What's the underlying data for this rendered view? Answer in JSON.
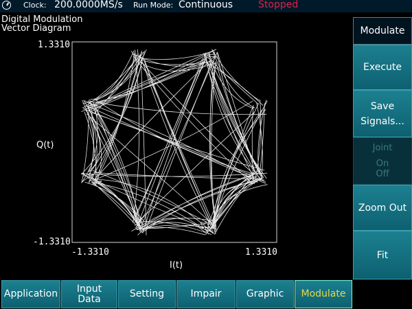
{
  "topbar": {
    "clock_label": "Clock:",
    "clock_value": "200.0000MS/s",
    "run_mode_label": "Run Mode:",
    "run_mode_value": "Continuous",
    "status": "Stopped"
  },
  "panel": {
    "title_line1": "Digital Modulation",
    "title_line2": "Vector Diagram"
  },
  "plot": {
    "y_max_label": "1.3310",
    "y_min_label": "-1.3310",
    "x_min_label": "-1.3310",
    "x_max_label": "1.3310",
    "ylabel": "Q(t)",
    "xlabel": "I(t)"
  },
  "side_menu": {
    "header": "Modulate",
    "execute": "Execute",
    "save_line1": "Save",
    "save_line2": "Signals...",
    "joint": "Joint",
    "joint_on": "On",
    "joint_off": "Off",
    "zoom_out": "Zoom Out",
    "fit": "Fit"
  },
  "tabs": [
    {
      "label": "Application"
    },
    {
      "label_line1": "Input",
      "label_line2": "Data"
    },
    {
      "label": "Setting"
    },
    {
      "label": "Impair"
    },
    {
      "label": "Graphic"
    },
    {
      "label": "Modulate",
      "active": true
    }
  ],
  "colors": {
    "status": "#e0204a",
    "button": "#1c8090",
    "active_tab_text": "#e8d84a",
    "trace": "#e6e6e6"
  }
}
